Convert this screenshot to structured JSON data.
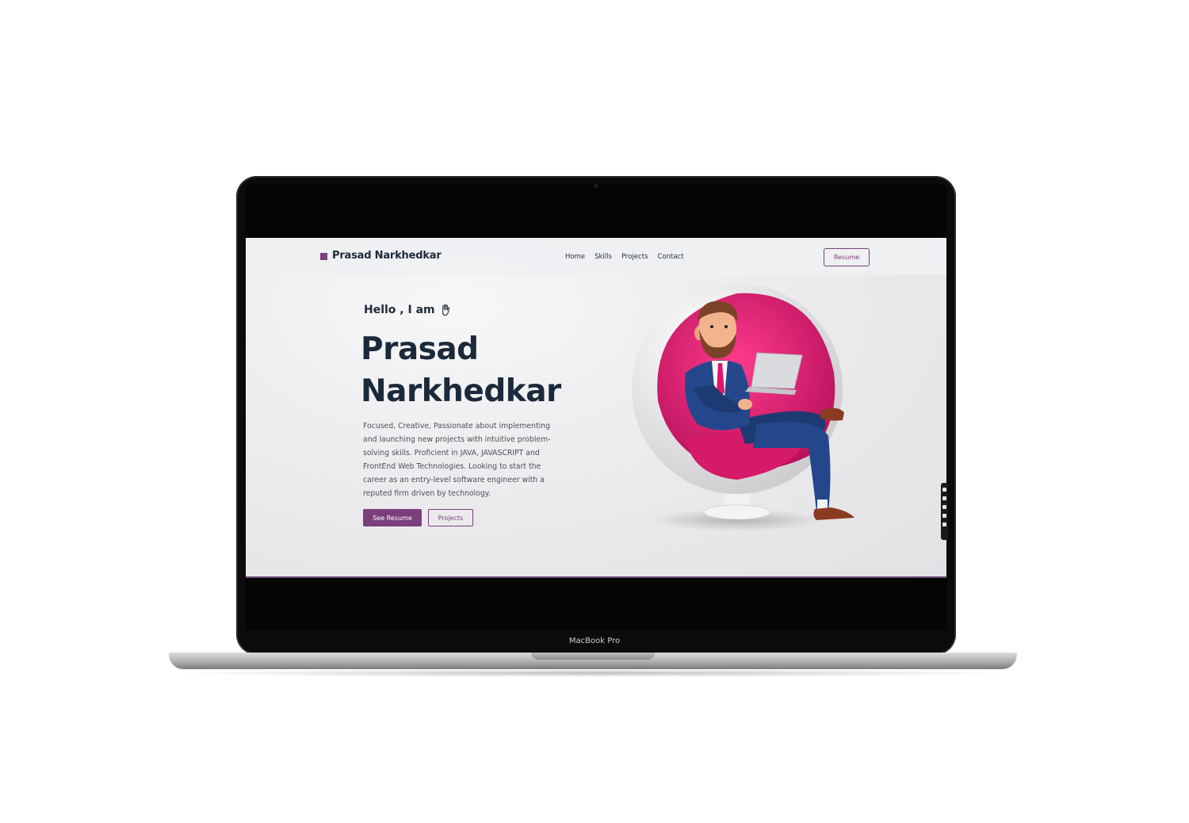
{
  "device": {
    "label": "MacBook Pro"
  },
  "navbar": {
    "brand": "Prasad Narkhedkar",
    "links": [
      "Home",
      "Skills",
      "Projects",
      "Contact"
    ],
    "resume_label": "Resume"
  },
  "hero": {
    "greeting": "Hello , I am",
    "name_line1": "Prasad",
    "name_line2": "Narkhedkar",
    "bio": "Focused, Creative, Passionate about implementing and launching new projects with intuitive problem-solving skills. Proficient in JAVA, JAVASCRIPT and FrontEnd Web Technologies. Looking to start the career as an entry-level software engineer with a reputed firm driven by technology.",
    "see_resume_label": "See Resume",
    "projects_label": "Projects"
  },
  "colors": {
    "accent": "#7b3f7e",
    "heading": "#1b2a3b",
    "chair": "#e0136e"
  },
  "icons": {
    "greeting": "waving-hand-icon",
    "illustration": "man-in-egg-chair-with-laptop"
  }
}
